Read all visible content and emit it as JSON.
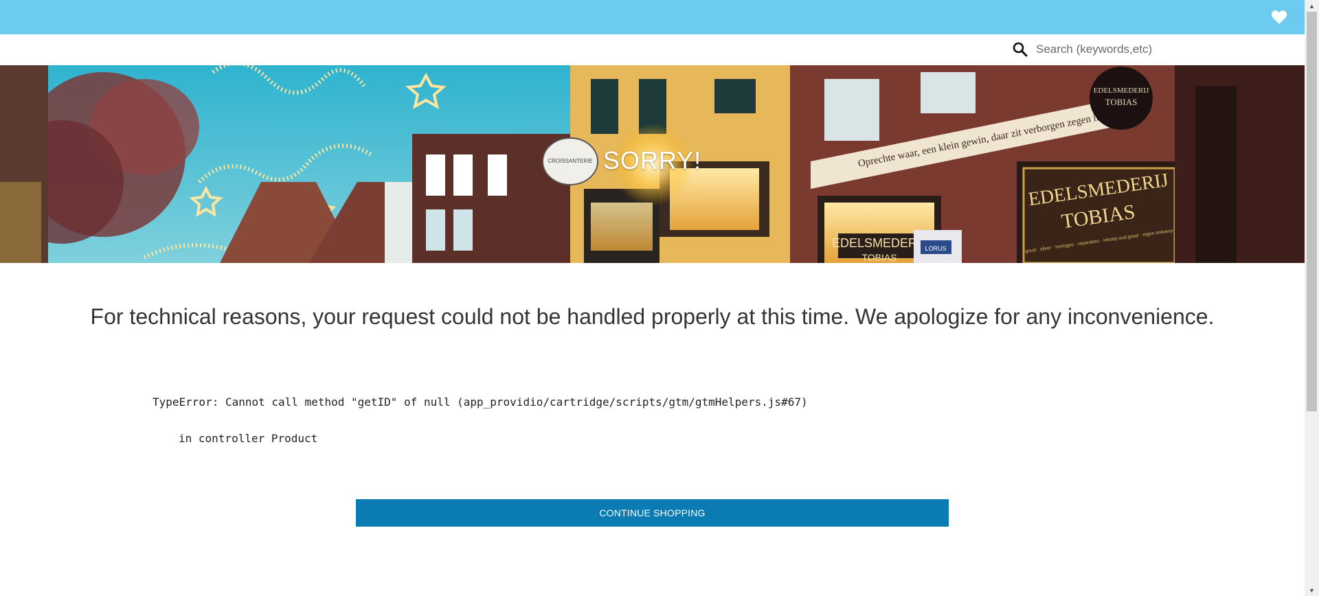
{
  "header": {
    "wishlist_icon": "heart-icon",
    "bar_color": "#6ccbee"
  },
  "search": {
    "placeholder": "Search (keywords,etc)",
    "icon": "search-icon"
  },
  "banner": {
    "title": "SORRY!",
    "shop_sign_line1": "EDELSMEDERIJ",
    "shop_sign_line2": "TOBIAS",
    "shop_window_text": "EDELSMEDERIJ",
    "shop_window_text2": "TOBIAS",
    "round_sign_line1": "EDELSMEDERIJ",
    "round_sign_line2": "TOBIAS",
    "facade_text": "Oprechte waar, een klein gewin, daar zit verborgen zegen in",
    "shop_window_small": "goud · zilver · horloges · reparaties · inkoop oud goud · eigen ontwerp",
    "teapot_sign": "CROISSANTERIE",
    "lorus_sign": "LORUS"
  },
  "main": {
    "message": "For technical reasons, your request could not be handled properly at this time. We apologize for any inconvenience.",
    "error_line_1": "TypeError: Cannot call method \"getID\" of null (app_providio/cartridge/scripts/gtm/gtmHelpers.js#67)",
    "error_line_2": "in controller Product",
    "continue_label": "CONTINUE SHOPPING",
    "button_color": "#0a7bb3"
  },
  "scrollbar": {
    "up_arrow": "▲",
    "down_arrow": "▼"
  }
}
